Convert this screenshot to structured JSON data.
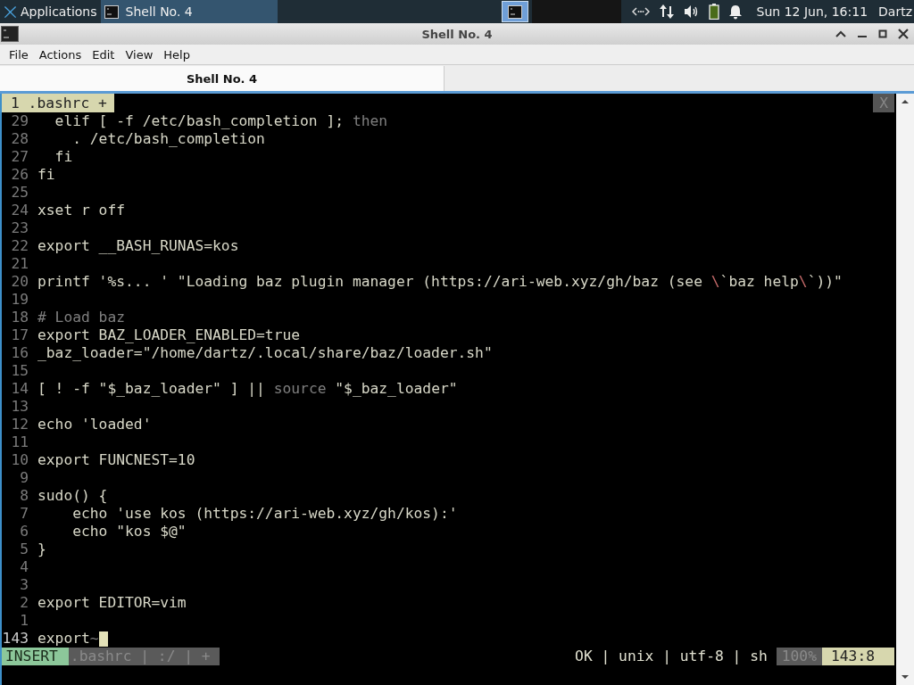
{
  "taskbar": {
    "app_menu": "Applications",
    "tasks": [
      {
        "label": "Shell No. 4",
        "selected": true
      }
    ],
    "clock": "Sun 12 Jun, 16:11",
    "user": "Dartz"
  },
  "window": {
    "title": "Shell No. 4",
    "menu": [
      "File",
      "Actions",
      "Edit",
      "View",
      "Help"
    ],
    "tabs": [
      {
        "label": "Shell No. 4",
        "selected": true
      }
    ]
  },
  "editor": {
    "buffer_tab": "1 .bashrc +",
    "close": "X",
    "lines": [
      {
        "number": "29",
        "cursor": false,
        "segments": [
          {
            "text": "  elif [ -f /etc/bash_completion ]; ",
            "kind": "code"
          },
          {
            "text": "then",
            "kind": "dim"
          }
        ]
      },
      {
        "number": "28",
        "cursor": false,
        "segments": [
          {
            "text": "    . /etc/bash_completion",
            "kind": "code"
          }
        ]
      },
      {
        "number": "27",
        "cursor": false,
        "segments": [
          {
            "text": "  fi",
            "kind": "code"
          }
        ]
      },
      {
        "number": "26",
        "cursor": false,
        "segments": [
          {
            "text": "fi",
            "kind": "code"
          }
        ]
      },
      {
        "number": "25",
        "cursor": false
      },
      {
        "number": "24",
        "cursor": false,
        "segments": [
          {
            "text": "xset r off",
            "kind": "code"
          }
        ]
      },
      {
        "number": "23",
        "cursor": false
      },
      {
        "number": "22",
        "cursor": false,
        "segments": [
          {
            "text": "export __BASH_RUNAS=kos",
            "kind": "code"
          }
        ]
      },
      {
        "number": "21",
        "cursor": false
      },
      {
        "number": "20",
        "cursor": false,
        "segments": [
          {
            "text": "printf '%s... ' \"Loading baz plugin manager (https://ari-web.xyz/gh/baz (see ",
            "kind": "code"
          },
          {
            "text": "\\",
            "kind": "escape"
          },
          {
            "text": "`baz help",
            "kind": "code"
          },
          {
            "text": "\\",
            "kind": "escape"
          },
          {
            "text": "`))\"",
            "kind": "code"
          }
        ]
      },
      {
        "number": "19",
        "cursor": false
      },
      {
        "number": "18",
        "cursor": false,
        "segments": [
          {
            "text": "# Load baz",
            "kind": "dim"
          }
        ]
      },
      {
        "number": "17",
        "cursor": false,
        "segments": [
          {
            "text": "export BAZ_LOADER_ENABLED=true",
            "kind": "code"
          }
        ]
      },
      {
        "number": "16",
        "cursor": false,
        "segments": [
          {
            "text": "_baz_loader=\"/home/dartz/.local/share/baz/loader.sh\"",
            "kind": "code"
          }
        ]
      },
      {
        "number": "15",
        "cursor": false
      },
      {
        "number": "14",
        "cursor": false,
        "segments": [
          {
            "text": "[ ! -f \"$_baz_loader\" ] || ",
            "kind": "code"
          },
          {
            "text": "source",
            "kind": "dim"
          },
          {
            "text": " \"$_baz_loader\"",
            "kind": "code"
          }
        ]
      },
      {
        "number": "13",
        "cursor": false
      },
      {
        "number": "12",
        "cursor": false,
        "segments": [
          {
            "text": "echo 'loaded'",
            "kind": "code"
          }
        ]
      },
      {
        "number": "11",
        "cursor": false
      },
      {
        "number": "10",
        "cursor": false,
        "segments": [
          {
            "text": "export FUNCNEST=10",
            "kind": "code"
          }
        ]
      },
      {
        "number": "9",
        "cursor": false
      },
      {
        "number": "8",
        "cursor": false,
        "segments": [
          {
            "text": "sudo() {",
            "kind": "code"
          }
        ]
      },
      {
        "number": "7",
        "cursor": false,
        "segments": [
          {
            "text": "    echo 'use kos (https://ari-web.xyz/gh/kos):'",
            "kind": "code"
          }
        ]
      },
      {
        "number": "6",
        "cursor": false,
        "segments": [
          {
            "text": "    echo \"kos $@\"",
            "kind": "code"
          }
        ]
      },
      {
        "number": "5",
        "cursor": false,
        "segments": [
          {
            "text": "}",
            "kind": "code"
          }
        ]
      },
      {
        "number": "4",
        "cursor": false
      },
      {
        "number": "3",
        "cursor": false
      },
      {
        "number": "2",
        "cursor": false,
        "segments": [
          {
            "text": "export EDITOR=vim",
            "kind": "code"
          }
        ]
      },
      {
        "number": "1",
        "cursor": false
      },
      {
        "number": "143",
        "cursor": true,
        "segments": [
          {
            "text": "export",
            "kind": "code"
          },
          {
            "text": "~",
            "kind": "dim"
          }
        ]
      }
    ],
    "status": {
      "mode": "INSERT",
      "file": ".bashrc | :/ | +",
      "info": "OK | unix | utf-8 | sh",
      "percent": "100%",
      "position": "143:8"
    }
  }
}
